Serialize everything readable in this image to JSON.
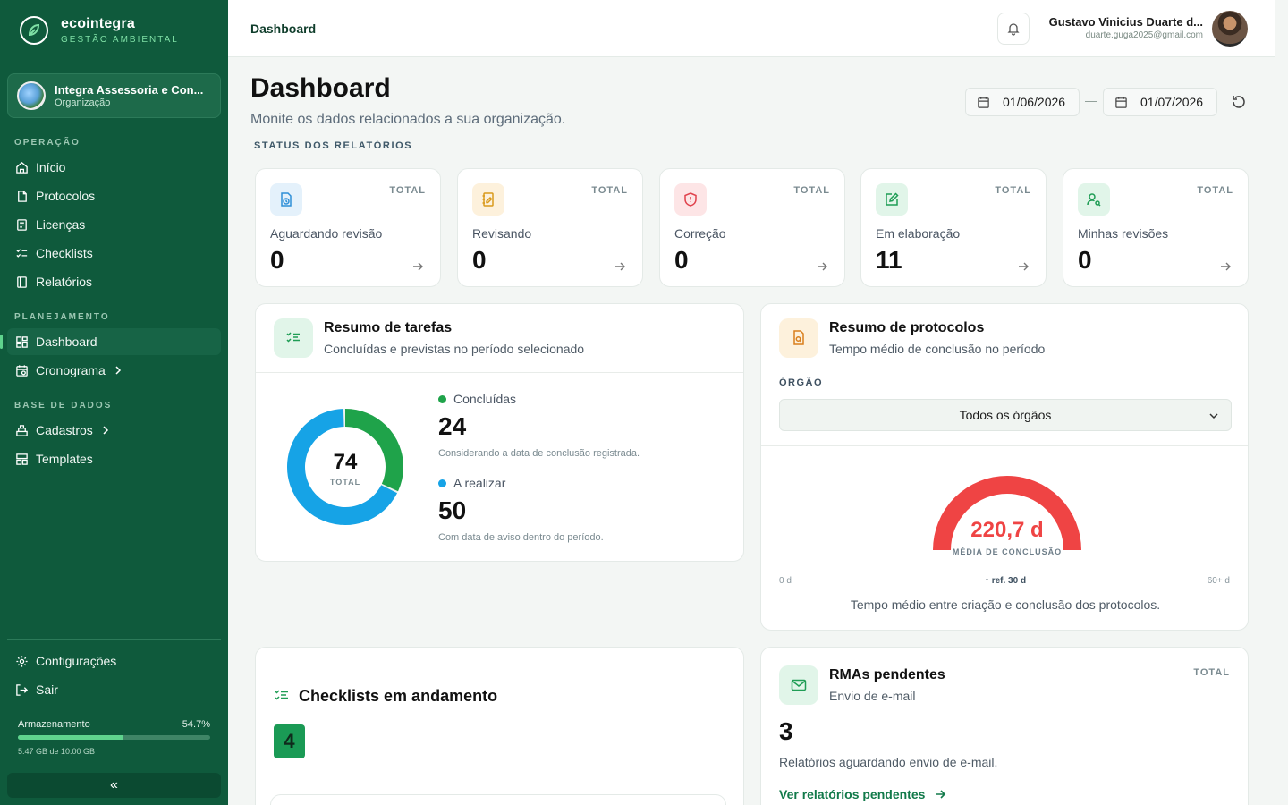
{
  "brand": {
    "name": "ecointegra",
    "subtitle": "GESTÃO AMBIENTAL"
  },
  "org": {
    "name": "Integra Assessoria e Con...",
    "role": "Organização"
  },
  "sidebar": {
    "sections": [
      {
        "label": "OPERAÇÃO"
      },
      {
        "label": "PLANEJAMENTO"
      },
      {
        "label": "BASE DE DADOS"
      }
    ],
    "items": [
      {
        "label": "Início",
        "icon": "home-icon"
      },
      {
        "label": "Protocolos",
        "icon": "file-icon"
      },
      {
        "label": "Licenças",
        "icon": "license-icon"
      },
      {
        "label": "Checklists",
        "icon": "checklist-icon"
      },
      {
        "label": "Relatórios",
        "icon": "book-icon"
      },
      {
        "label": "Dashboard",
        "icon": "dashboard-icon",
        "active": true
      },
      {
        "label": "Cronograma",
        "icon": "calendar-icon"
      },
      {
        "label": "Cadastros",
        "icon": "database-icon"
      },
      {
        "label": "Templates",
        "icon": "template-icon"
      }
    ],
    "footer": [
      {
        "label": "Configurações",
        "icon": "gear-icon"
      },
      {
        "label": "Sair",
        "icon": "logout-icon"
      }
    ],
    "storage": {
      "label": "Armazenamento",
      "percent_label": "54.7%",
      "percent": 54.7,
      "detail": "5.47 GB de 10.00 GB"
    },
    "collapse_label": "«"
  },
  "header": {
    "title": "Dashboard",
    "user": {
      "name": "Gustavo Vinicius Duarte d...",
      "email": "duarte.guga2025@gmail.com"
    }
  },
  "main": {
    "title": "Dashboard",
    "subtitle": "Monite os dados relacionados a sua organização.",
    "date_start": "01/06/2026",
    "date_end": "01/07/2026",
    "date_separator": "—",
    "section_title": "STATUS DOS RELATÓRIOS",
    "stats": [
      {
        "label": "Aguardando revisão",
        "total_label": "TOTAL",
        "value": "0",
        "color": "#2f8fd8",
        "bg": "#e4f1fb"
      },
      {
        "label": "Revisando",
        "total_label": "TOTAL",
        "value": "0",
        "color": "#d99a1c",
        "bg": "#fdf1dc"
      },
      {
        "label": "Correção",
        "total_label": "TOTAL",
        "value": "0",
        "color": "#e0424c",
        "bg": "#fde5e6"
      },
      {
        "label": "Em elaboração",
        "total_label": "TOTAL",
        "value": "11",
        "color": "#1f9d55",
        "bg": "#e1f5e9"
      },
      {
        "label": "Minhas revisões",
        "total_label": "TOTAL",
        "value": "0",
        "color": "#1f9d55",
        "bg": "#e1f5e9"
      }
    ],
    "tasks": {
      "title": "Resumo de tarefas",
      "subtitle": "Concluídas e previstas no período selecionado",
      "total": "74",
      "total_label": "TOTAL",
      "done": {
        "label": "Concluídas",
        "value": 24,
        "note": "Considerando a data de conclusão registrada.",
        "color": "#1fa34a"
      },
      "todo": {
        "label": "A realizar",
        "value": 50,
        "note": "Com data de aviso dentro do período.",
        "color": "#16a3e6"
      }
    },
    "protocols": {
      "title": "Resumo de protocolos",
      "subtitle": "Tempo médio de conclusão no período",
      "filter_label": "ÓRGÃO",
      "filter_value": "Todos os órgãos",
      "gauge_value": "220,7 d",
      "gauge_label": "MÉDIA DE CONCLUSÃO",
      "gauge_color": "#ef4444",
      "min_label": "0 d",
      "ref_label": "↑ ref. 30 d",
      "max_label": "60+ d",
      "note": "Tempo médio entre criação e conclusão dos protocolos."
    },
    "checklists": {
      "title": "Checklists em andamento",
      "count": "4"
    },
    "rmas": {
      "title": "RMAs pendentes",
      "subtitle": "Envio de e-mail",
      "total_label": "TOTAL",
      "value": "3",
      "note": "Relatórios aguardando envio de e-mail.",
      "link": "Ver relatórios pendentes"
    }
  }
}
